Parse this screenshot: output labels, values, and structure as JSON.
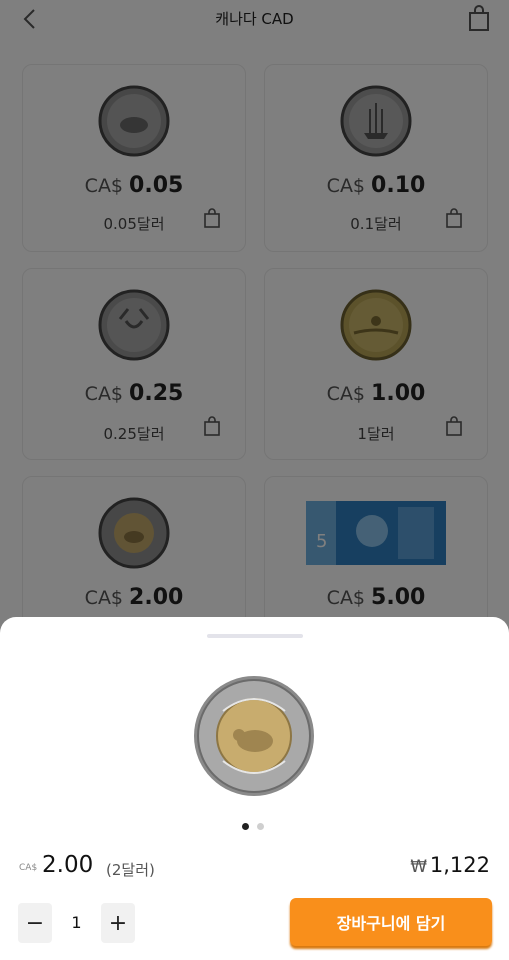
{
  "header": {
    "title": "캐나다 CAD",
    "back_icon": "chevron-left-icon",
    "cart_icon": "shopping-bag-icon"
  },
  "items": [
    {
      "currency": "CA$",
      "amount": "0.05",
      "sub": "0.05달러"
    },
    {
      "currency": "CA$",
      "amount": "0.10",
      "sub": "0.1달러"
    },
    {
      "currency": "CA$",
      "amount": "0.25",
      "sub": "0.25달러"
    },
    {
      "currency": "CA$",
      "amount": "1.00",
      "sub": "1달러"
    },
    {
      "currency": "CA$",
      "amount": "2.00",
      "sub": ""
    },
    {
      "currency": "CA$",
      "amount": "5.00",
      "sub": ""
    }
  ],
  "sheet": {
    "currency": "CA$",
    "amount": "2.00",
    "sub": "(2달러)",
    "krw_symbol": "₩",
    "krw_amount": "1,122",
    "quantity": "1",
    "minus_label": "−",
    "plus_label": "+",
    "cart_label": "장바구니에 담기",
    "image_count": 2,
    "active_image": 1
  },
  "colors": {
    "accent": "#f98f1b",
    "text": "#222222",
    "dim_overlay": "rgba(0,0,0,0.5)"
  }
}
